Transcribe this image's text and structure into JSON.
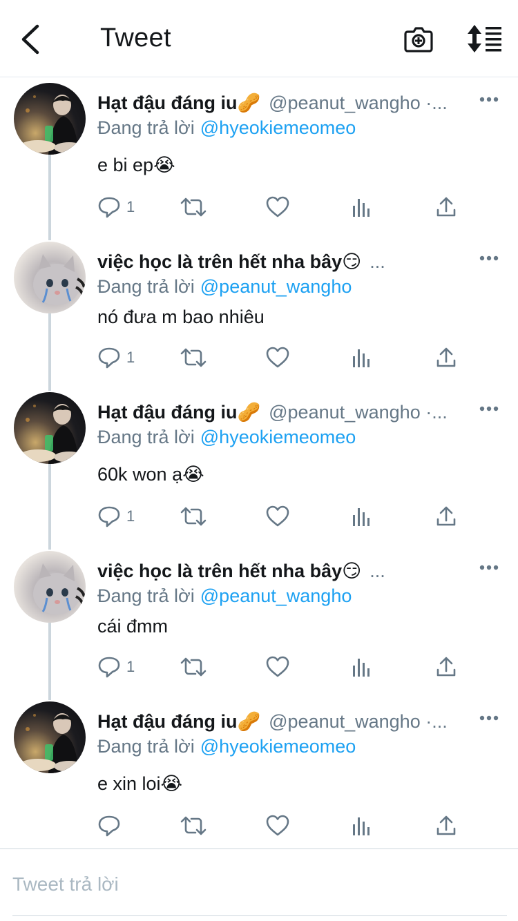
{
  "header": {
    "title": "Tweet",
    "back_icon": "chevron-left-icon",
    "camera_icon": "camera-add-icon",
    "sort_icon": "sort-icon"
  },
  "tweets": [
    {
      "display_name": "Hạt đậu đáng iu🥜",
      "handle": "@peanut_wangho ·...",
      "reply_prefix": "Đang trả lời",
      "reply_to": "@hyeokiemeomeo",
      "text": "e bi ep😭",
      "reply_count": "1"
    },
    {
      "display_name": "việc học là trên hết nha bây😏",
      "handle": "...",
      "reply_prefix": "Đang trả lời",
      "reply_to": "@peanut_wangho",
      "text": "nó đưa m bao nhiêu",
      "reply_count": "1"
    },
    {
      "display_name": "Hạt đậu đáng iu🥜",
      "handle": "@peanut_wangho ·...",
      "reply_prefix": "Đang trả lời",
      "reply_to": "@hyeokiemeomeo",
      "text": "60k won ạ😭",
      "reply_count": "1"
    },
    {
      "display_name": "việc học là trên hết nha bây😏",
      "handle": "...",
      "reply_prefix": "Đang trả lời",
      "reply_to": "@peanut_wangho",
      "text": "cái đmm",
      "reply_count": "1"
    },
    {
      "display_name": "Hạt đậu đáng iu🥜",
      "handle": "@peanut_wangho ·...",
      "reply_prefix": "Đang trả lời",
      "reply_to": "@hyeokiemeomeo",
      "text": "e xin loi😭",
      "reply_count": ""
    }
  ],
  "reply_box": {
    "placeholder": "Tweet trả lời"
  },
  "colors": {
    "accent": "#1da1f2",
    "secondary_text": "#657786",
    "icon": "#657786",
    "divider": "#ccd6dd"
  }
}
